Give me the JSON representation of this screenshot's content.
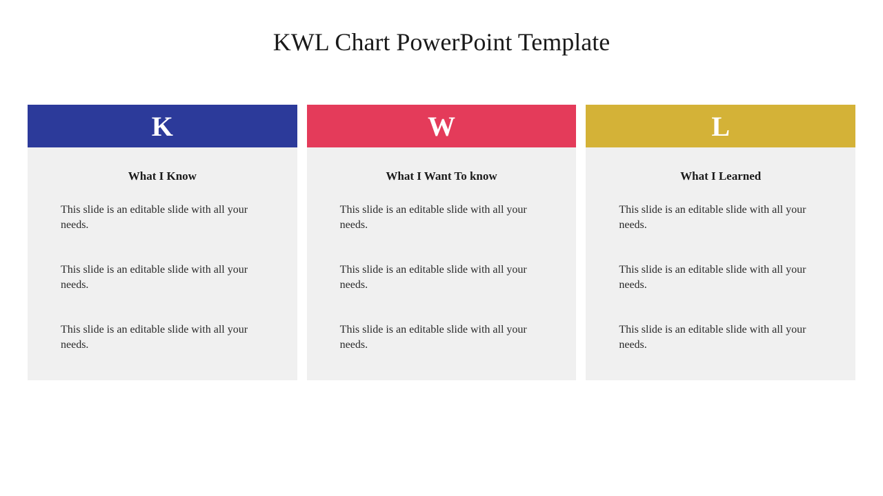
{
  "title": "KWL Chart PowerPoint Template",
  "columns": [
    {
      "letter": "K",
      "color": "#2c3a9a",
      "subtitle": "What I Know",
      "items": [
        "This slide is an editable slide with all your needs.",
        "This slide is an editable slide with all your needs.",
        "This slide is an editable slide with all your needs."
      ]
    },
    {
      "letter": "W",
      "color": "#e43b5a",
      "subtitle": "What I Want To know",
      "items": [
        "This slide is an editable slide with all your needs.",
        "This slide is an editable slide with all your needs.",
        "This slide is an editable slide with all your needs."
      ]
    },
    {
      "letter": "L",
      "color": "#d4b237",
      "subtitle": "What I Learned",
      "items": [
        "This slide is an editable slide with all your needs.",
        "This slide is an editable slide with all your needs.",
        "This slide is an editable slide with all your needs."
      ]
    }
  ]
}
